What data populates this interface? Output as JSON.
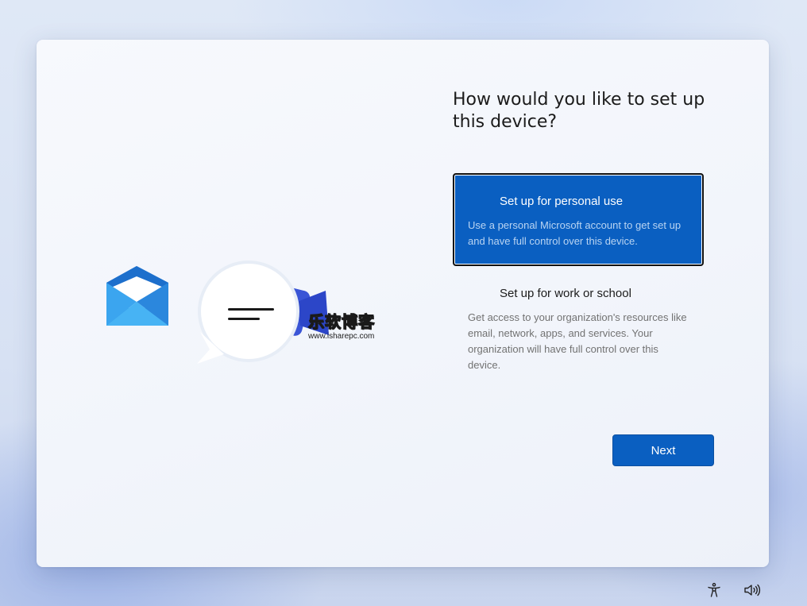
{
  "setup": {
    "title": "How would you like to set up this device?",
    "options": [
      {
        "title": "Set up for personal use",
        "description": "Use a personal Microsoft account to get set up and have full control over this device.",
        "selected": true
      },
      {
        "title": "Set up for work or school",
        "description": "Get access to your organization's resources like email, network, apps, and services. Your organization will have full control over this device.",
        "selected": false
      }
    ],
    "next_label": "Next"
  },
  "watermark": {
    "title": "乐软博客",
    "url": "www.isharepc.com"
  },
  "illustration": {
    "icons": [
      "mail-icon",
      "chat-bubble-icon",
      "video-icon"
    ]
  },
  "taskbar": {
    "icons": [
      "accessibility-icon",
      "volume-icon"
    ]
  },
  "colors": {
    "accent": "#0a5fc1",
    "selected_border": "#111111"
  }
}
